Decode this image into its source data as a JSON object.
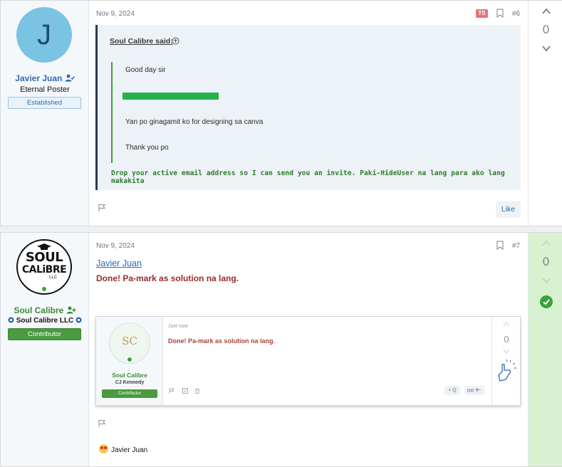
{
  "post1": {
    "user": {
      "avatar_letter": "J",
      "name": "Javier Juan",
      "title": "Eternal Poster",
      "badge": "Established"
    },
    "date": "Nov 9, 2024",
    "ts_badge": "TS",
    "post_number": "#6",
    "quote": {
      "author": "Soul Calibre said:",
      "lines": [
        "Good day sir",
        "Yan po ginagamit ko for designing sa canva",
        "Thank you po"
      ]
    },
    "message": "Drop your active email address so I can send you an invite. Paki-HideUser na lang para ako lang makakita",
    "like_label": "Like",
    "vote_count": "0"
  },
  "post2": {
    "user": {
      "logo_text": [
        "SOUL",
        "CALiBRE",
        "LLC"
      ],
      "name": "Soul Calibre",
      "organization": "Soul Calibre LLC",
      "badge": "Contributor"
    },
    "date": "Nov 9, 2024",
    "post_number": "#7",
    "mention": "Javier Juan",
    "message": "Done! Pa-mark as solution na lang.",
    "embedded_screenshot": {
      "monogram": "SC",
      "user_name": "Soul Calibre",
      "organization": "CJ Kennedy",
      "badge": "Contributor",
      "time": "Just now",
      "message": "Done! Pa-mark as solution na lang.",
      "vote_count": "0",
      "quote_button": "+ Q"
    },
    "reaction_user": "Javier Juan",
    "vote_count": "0"
  },
  "colors": {
    "accent_blue": "#2a6bb8",
    "solution_green": "#3aa23a",
    "quote_green": "#2f7a2b",
    "done_red": "#9a2b25"
  }
}
